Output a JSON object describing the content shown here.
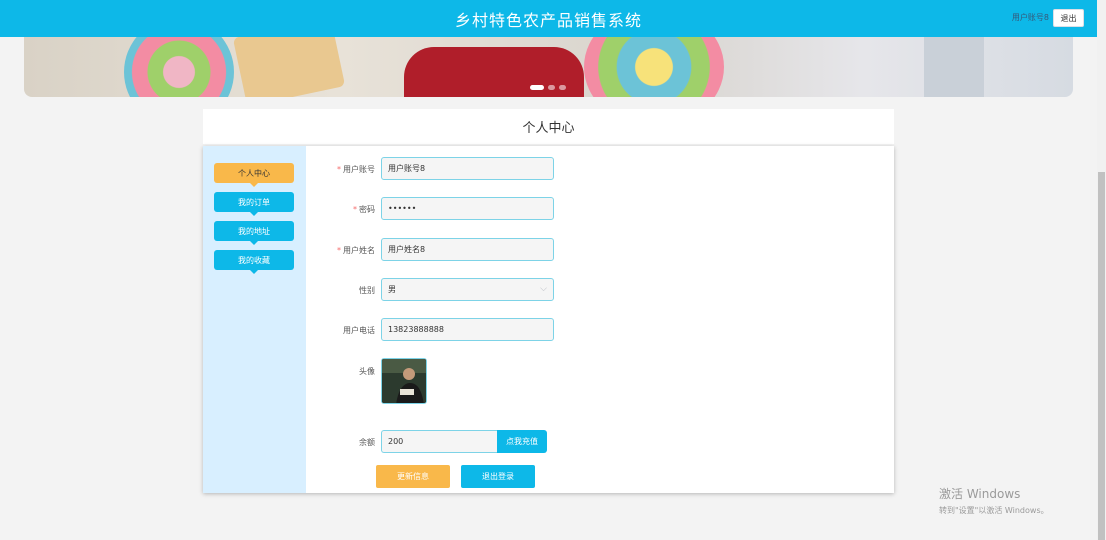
{
  "header": {
    "title": "乡村特色农产品销售系统",
    "user": "用户账号8",
    "logout_label": "退出"
  },
  "card": {
    "title": "个人中心"
  },
  "sidebar": {
    "items": [
      {
        "label": "个人中心",
        "active": true
      },
      {
        "label": "我的订单",
        "active": false
      },
      {
        "label": "我的地址",
        "active": false
      },
      {
        "label": "我的收藏",
        "active": false
      }
    ]
  },
  "form": {
    "account": {
      "label": "用户账号",
      "required": true,
      "value": "用户账号8"
    },
    "password": {
      "label": "密码",
      "required": true,
      "value": "••••••"
    },
    "name": {
      "label": "用户姓名",
      "required": true,
      "value": "用户姓名8"
    },
    "gender": {
      "label": "性别",
      "value": "男"
    },
    "phone": {
      "label": "用户电话",
      "value": "13823888888"
    },
    "avatar": {
      "label": "头像"
    },
    "balance": {
      "label": "余额",
      "value": "200",
      "recharge_label": "点我充值"
    },
    "update_label": "更新信息",
    "exit_label": "退出登录"
  },
  "watermark": {
    "line1": "激活 Windows",
    "line2": "转到\"设置\"以激活 Windows。"
  },
  "colors": {
    "primary": "#0db8e8",
    "accent": "#f9b84a",
    "sidebar": "#d8efff"
  }
}
